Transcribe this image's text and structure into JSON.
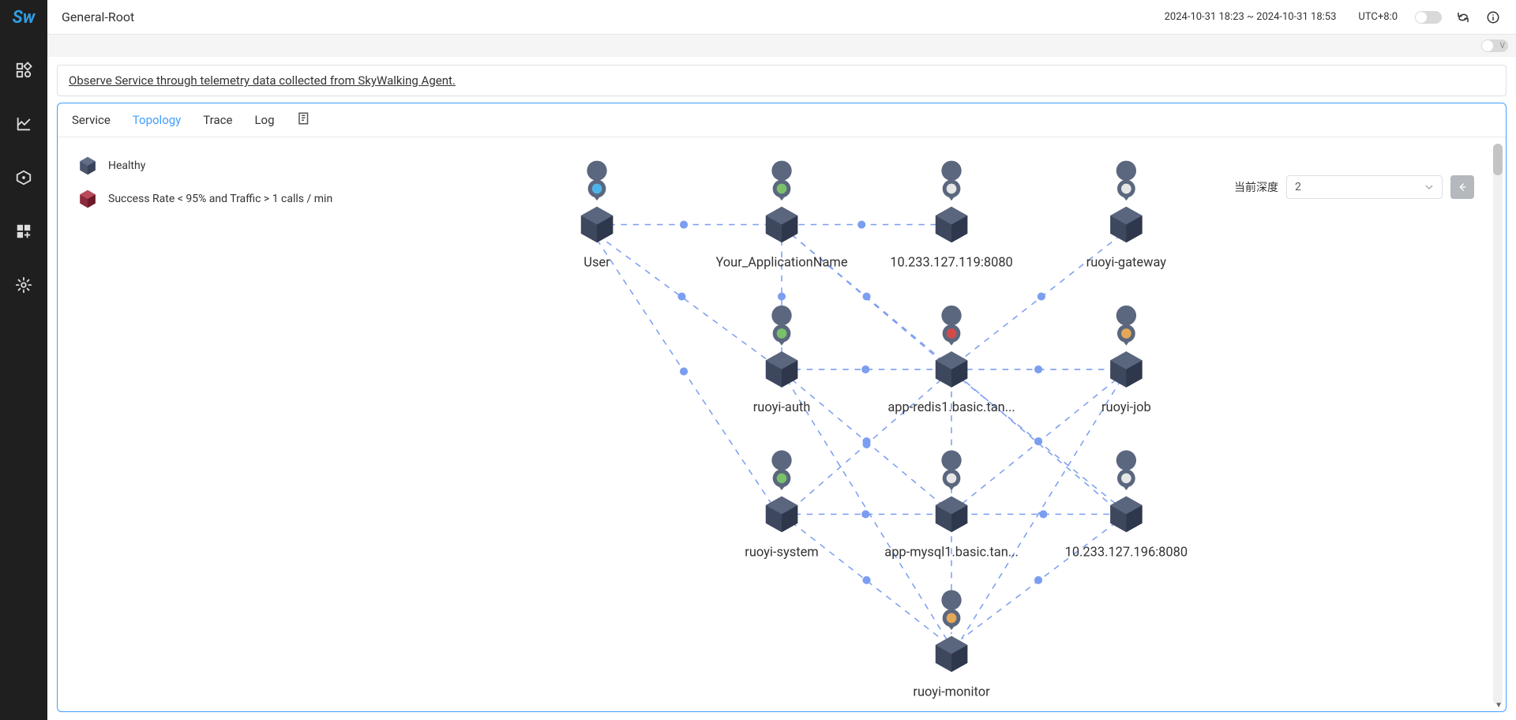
{
  "header": {
    "page_title": "General-Root",
    "time_range": "2024-10-31 18:23 ~ 2024-10-31 18:53",
    "tz": "UTC+8:0",
    "v_label": "V"
  },
  "description": "Observe Service through telemetry data collected from SkyWalking Agent.",
  "tabs": {
    "service": "Service",
    "topology": "Topology",
    "trace": "Trace",
    "log": "Log"
  },
  "legend": {
    "healthy": "Healthy",
    "unhealthy": "Success Rate < 95% and Traffic > 1 calls / min"
  },
  "depth": {
    "label": "当前深度",
    "value": "2"
  },
  "nodes": {
    "user": "User",
    "your_app": "Your_ApplicationName",
    "ip1": "10.233.127.119:8080",
    "gateway": "ruoyi-gateway",
    "auth": "ruoyi-auth",
    "redis": "app-redis1.basic.tan...",
    "job": "ruoyi-job",
    "system": "ruoyi-system",
    "mysql": "app-mysql1.basic.tan...",
    "ip2": "10.233.127.196:8080",
    "monitor": "ruoyi-monitor"
  }
}
